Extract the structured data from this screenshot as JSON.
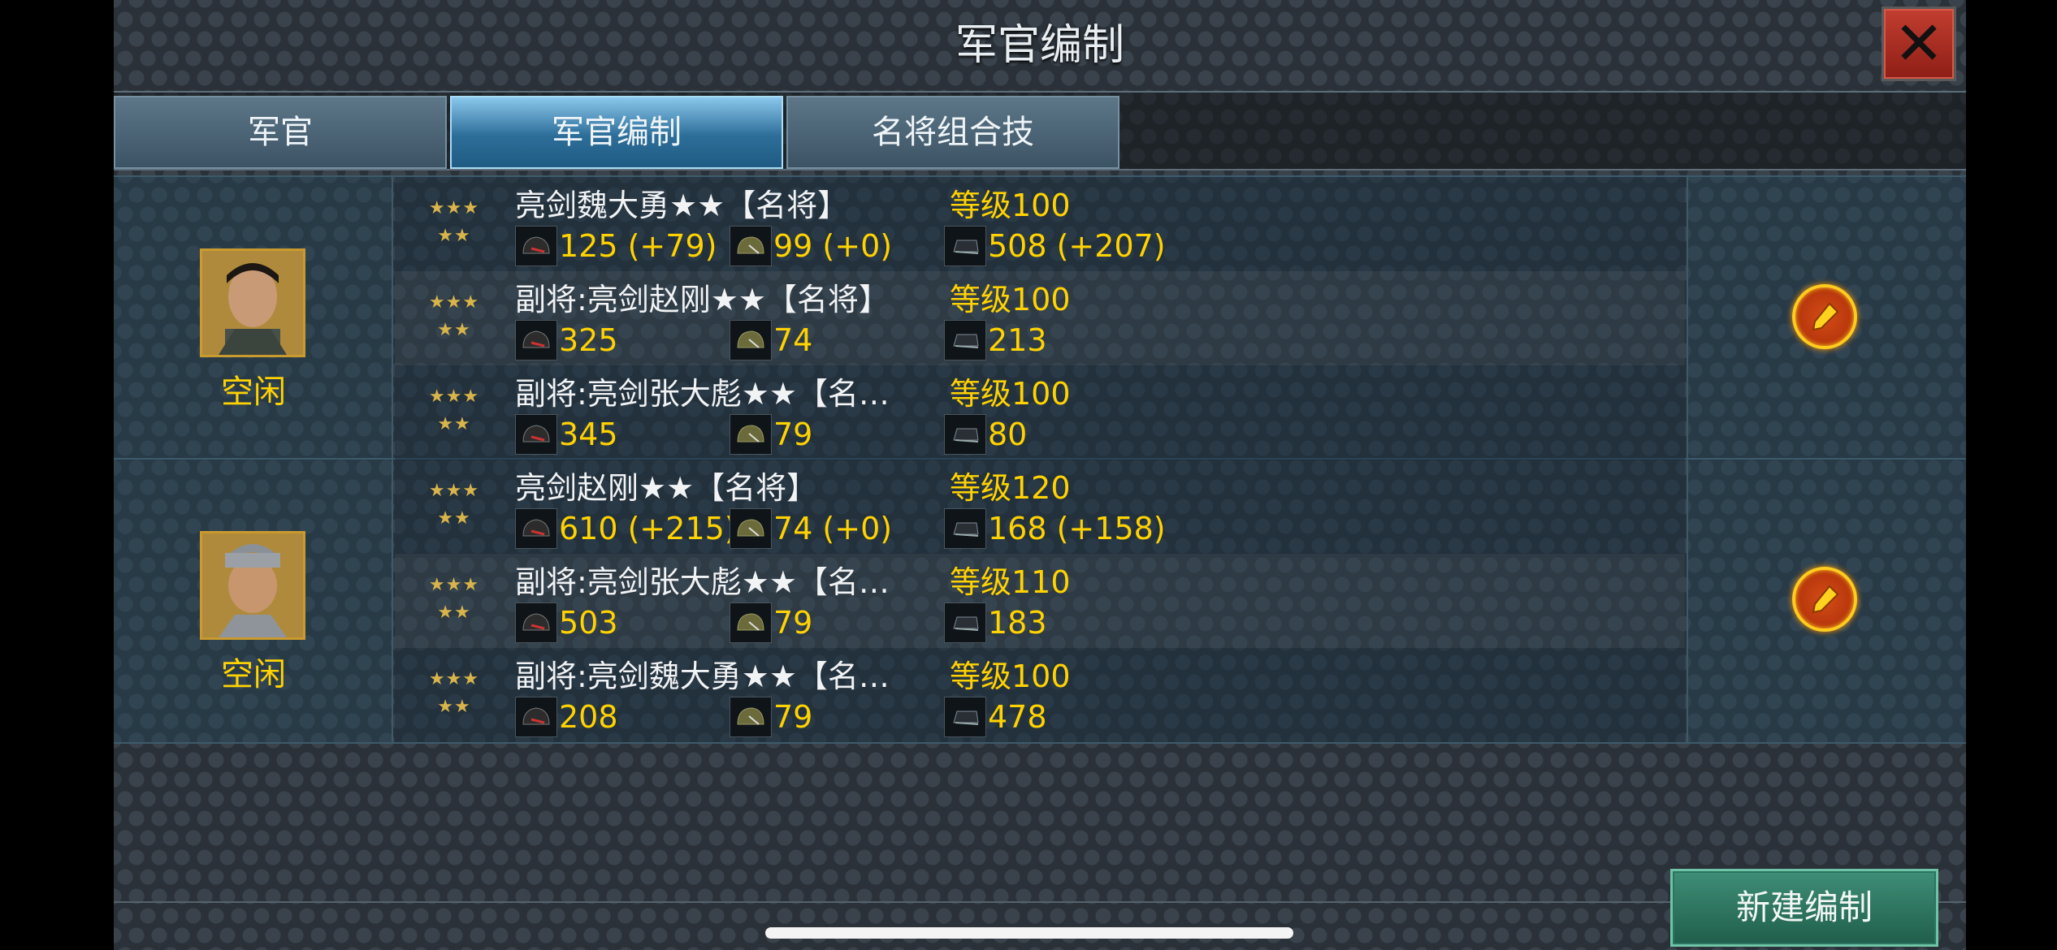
{
  "window": {
    "title": "军官编制",
    "close_label": "✕"
  },
  "tabs": [
    {
      "label": "军官"
    },
    {
      "label": "军官编制"
    },
    {
      "label": "名将组合技"
    }
  ],
  "groups": [
    {
      "status": "空闲",
      "rows": [
        {
          "stars": "★★★ ★★",
          "name": "亮剑魏大勇★★【名将】",
          "level": "等级100",
          "attack": "125 (+79)",
          "defense": "99 (+0)",
          "troops": "508 (+207)"
        },
        {
          "stars": "★★★ ★★",
          "name": "副将:亮剑赵刚★★【名将】",
          "level": "等级100",
          "attack": "325",
          "defense": "74",
          "troops": "213"
        },
        {
          "stars": "★★★ ★★",
          "name": "副将:亮剑张大彪★★【名…",
          "level": "等级100",
          "attack": "345",
          "defense": "79",
          "troops": "80"
        }
      ]
    },
    {
      "status": "空闲",
      "rows": [
        {
          "stars": "★★★ ★★",
          "name": "亮剑赵刚★★【名将】",
          "level": "等级120",
          "attack": "610 (+215)",
          "defense": "74 (+0)",
          "troops": "168 (+158)"
        },
        {
          "stars": "★★★ ★★",
          "name": "副将:亮剑张大彪★★【名…",
          "level": "等级110",
          "attack": "503",
          "defense": "79",
          "troops": "183"
        },
        {
          "stars": "★★★ ★★",
          "name": "副将:亮剑魏大勇★★【名…",
          "level": "等级100",
          "attack": "208",
          "defense": "79",
          "troops": "478"
        }
      ]
    }
  ],
  "actions": {
    "new_formation_label": "新建编制"
  }
}
